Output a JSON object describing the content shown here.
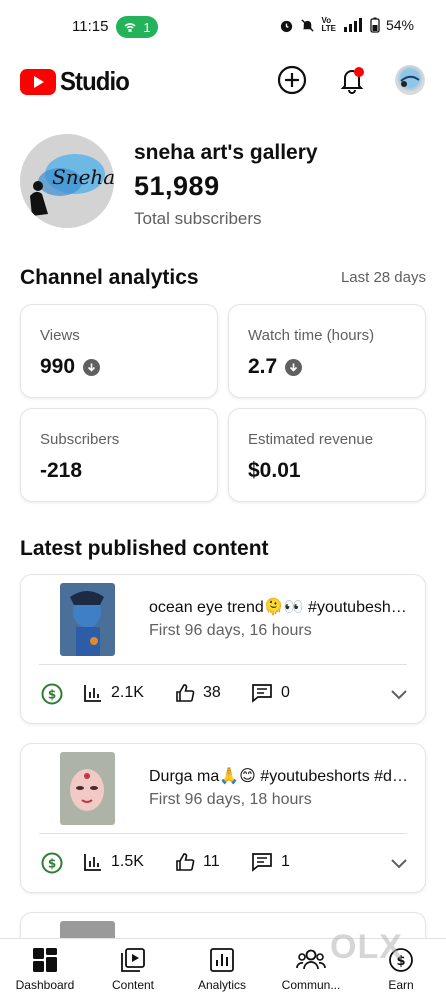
{
  "status_bar": {
    "time": "11:15",
    "hotspot_count": "1",
    "battery": "54%"
  },
  "header": {
    "logo_text": "Studio"
  },
  "channel": {
    "name": "sneha art's gallery",
    "avatar_text": "Sneha",
    "subscribers": "51,989",
    "subscribers_label": "Total subscribers"
  },
  "analytics": {
    "title": "Channel analytics",
    "period": "Last 28 days",
    "cards": [
      {
        "label": "Views",
        "value": "990"
      },
      {
        "label": "Watch time (hours)",
        "value": "2.7"
      },
      {
        "label": "Subscribers",
        "value": "-218"
      },
      {
        "label": "Estimated revenue",
        "value": "$0.01"
      }
    ]
  },
  "latest": {
    "title": "Latest published content",
    "items": [
      {
        "title": "ocean eye trend🫠👀 #youtubeshorts",
        "meta": "First 96 days, 16 hours",
        "views": "2.1K",
        "likes": "38",
        "comments": "0"
      },
      {
        "title": "Durga ma🙏😊 #youtubeshorts #durgamaa",
        "meta": "First 96 days, 18 hours",
        "views": "1.5K",
        "likes": "11",
        "comments": "1"
      }
    ]
  },
  "nav": [
    "Dashboard",
    "Content",
    "Analytics",
    "Commun...",
    "Earn"
  ],
  "watermark": "OLX",
  "colors": {
    "brand_red": "#ff0000",
    "hotspot_green": "#24b35a",
    "monetize_green": "#2e7d32",
    "secondary_text": "#606060"
  }
}
